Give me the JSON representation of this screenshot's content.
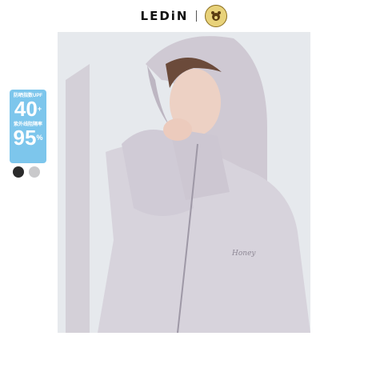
{
  "header": {
    "brand": "LEDiN"
  },
  "upf": {
    "line1": "防晒指数UPF",
    "value1": "40",
    "value1_suffix": "+",
    "line2": "紫外线阻隔率",
    "value2": "95",
    "value2_suffix": "%"
  },
  "swatches": [
    {
      "name": "black",
      "color": "#2b2b2b"
    },
    {
      "name": "grey",
      "color": "#c9c9cb"
    }
  ],
  "jacket": {
    "chest_text": "Honey"
  },
  "colors": {
    "accent": "#7dc6ec",
    "jacket": "#d7d3dc"
  }
}
